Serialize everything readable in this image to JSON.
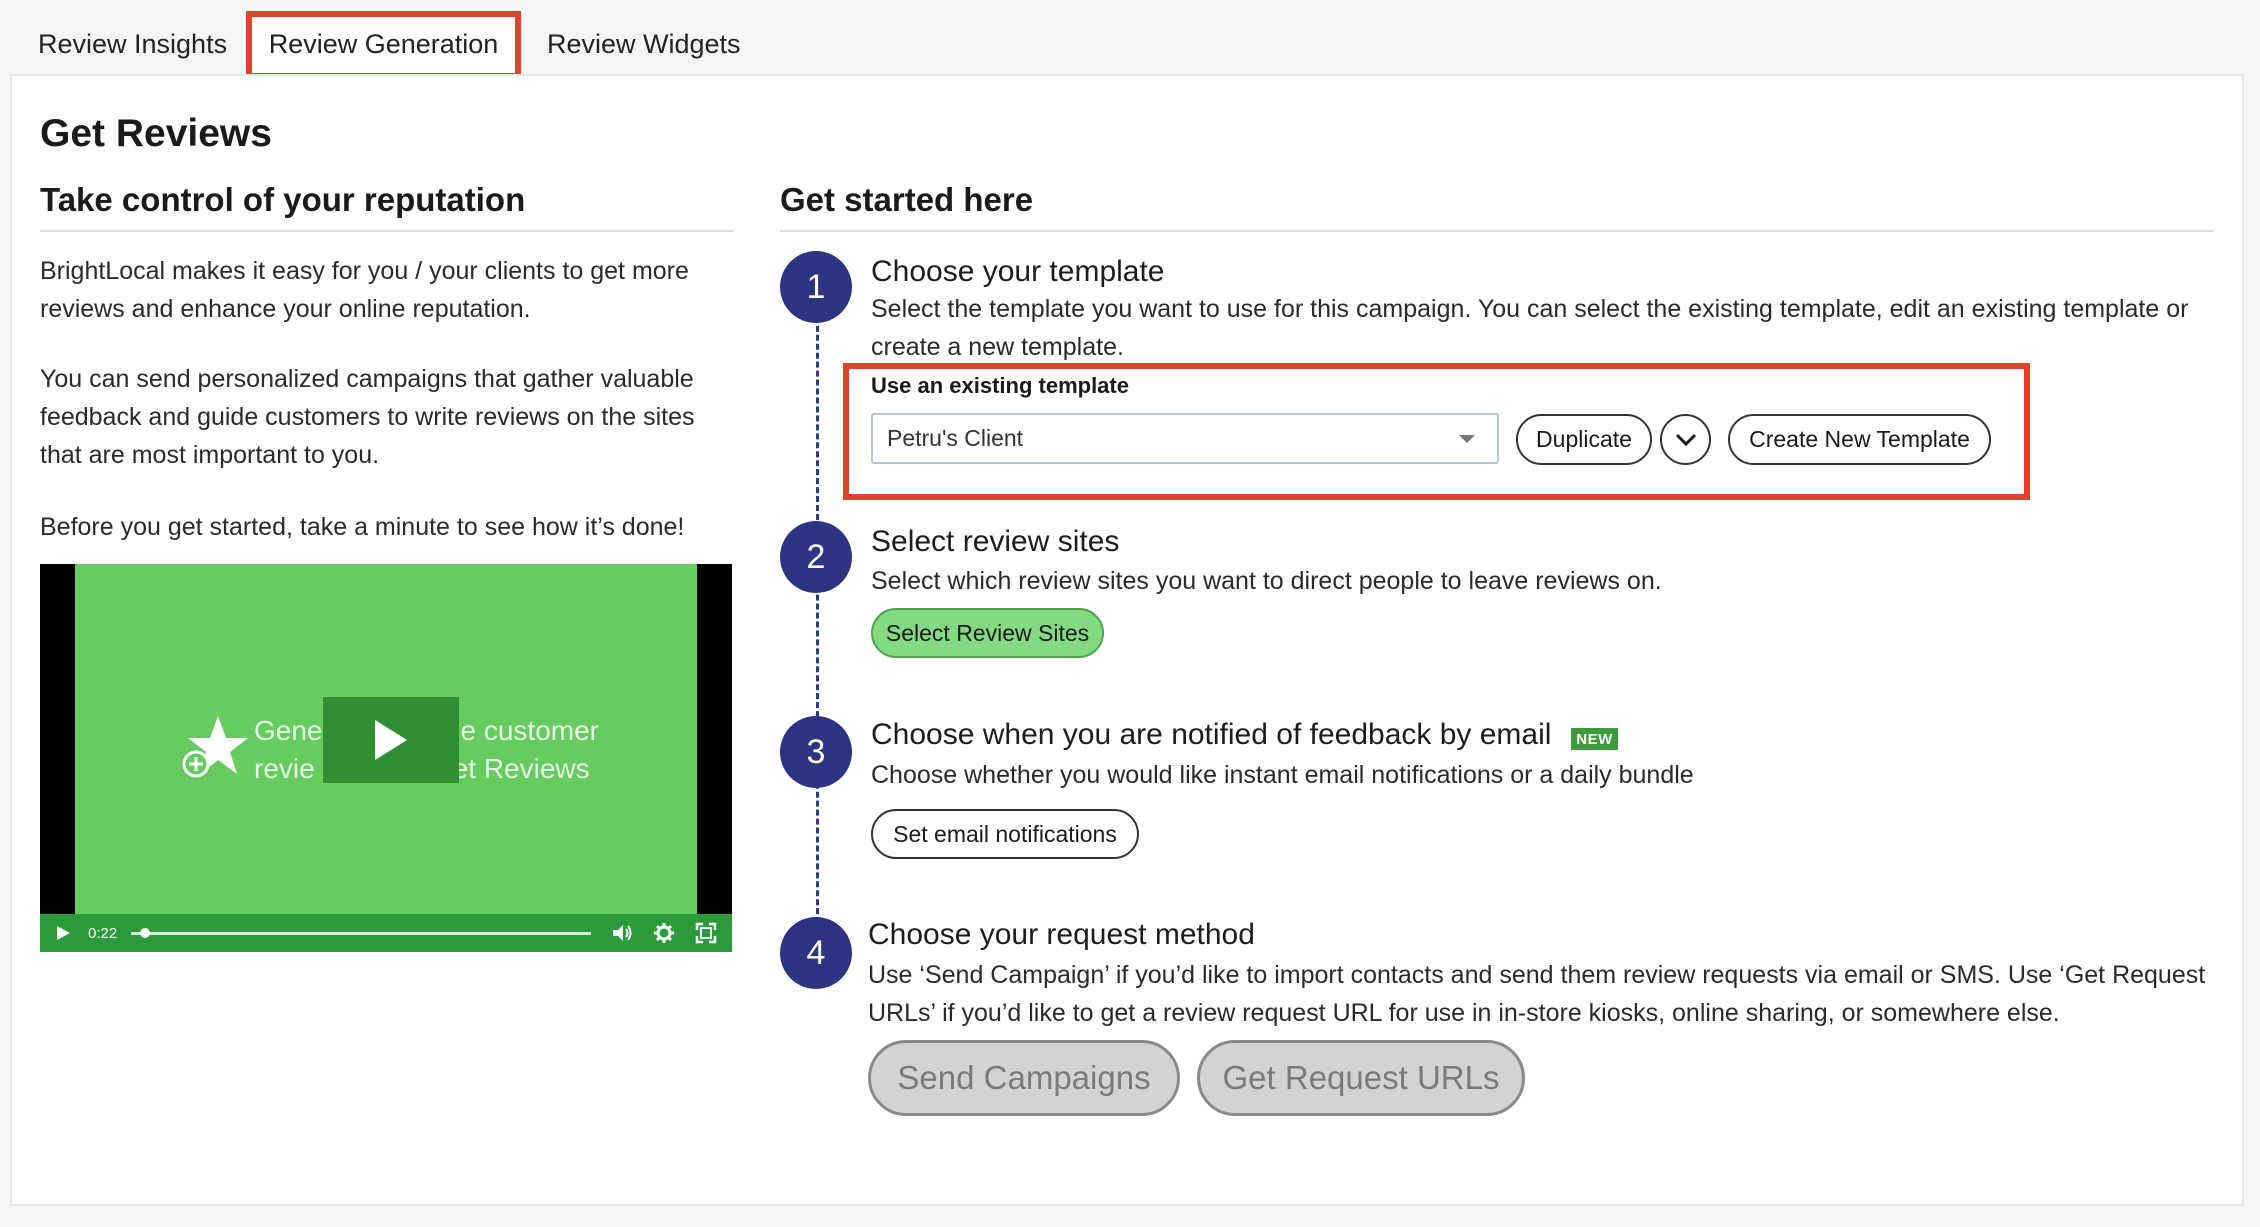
{
  "tabs": {
    "review_insights": "Review Insights",
    "review_generation": "Review Generation",
    "review_widgets": "Review Widgets"
  },
  "page_title": "Get Reviews",
  "left": {
    "heading": "Take control of your reputation",
    "p1": "BrightLocal makes it easy for you / your clients to get more reviews and enhance your online reputation.",
    "p2": "You can send personalized campaigns that gather valuable feedback and guide customers to write reviews on the sites that are most important to you.",
    "p3": "Before you get started, take a minute to see how it’s done!",
    "video": {
      "overlay_text_line1": "Gene",
      "overlay_text_line1b": "e customer",
      "overlay_text_line2": "revie",
      "overlay_text_line2b": "et Reviews",
      "time": "0:22",
      "progress_fraction": 0.03
    }
  },
  "right": {
    "heading": "Get started here",
    "steps": [
      {
        "number": "1",
        "title": "Choose your template",
        "desc": "Select the template you want to use for this campaign. You can select the existing template, edit an existing template or create a new template.",
        "field_label": "Use an existing template",
        "select_value": "Petru's Client",
        "duplicate_label": "Duplicate",
        "create_label": "Create New Template"
      },
      {
        "number": "2",
        "title": "Select review sites",
        "desc": "Select which review sites you want to direct people to leave reviews on.",
        "button_label": "Select Review Sites"
      },
      {
        "number": "3",
        "title": "Choose when you are notified of feedback by email",
        "badge": "NEW",
        "desc": "Choose whether you would like instant email notifications or a daily bundle",
        "button_label": "Set email notifications"
      },
      {
        "number": "4",
        "title": "Choose your request method",
        "desc": "Use ‘Send Campaign’ if you’d like to import contacts and send them review requests via email or SMS. Use ‘Get Request URLs’ if you’d like to get a review request URL for use in in-store kiosks, online sharing, or somewhere else.",
        "send_label": "Send Campaigns",
        "urls_label": "Get Request URLs"
      }
    ]
  },
  "colors": {
    "accent_red": "#e5402b",
    "step_navy": "#2d3482",
    "video_green": "#66cc5f",
    "sites_button_green": "#83da83",
    "new_badge": "#3c9b3c"
  },
  "icons": [
    "play-icon",
    "star-plus-icon",
    "volume-icon",
    "gear-icon",
    "fullscreen-icon",
    "chevron-down-icon",
    "caret-down-icon"
  ]
}
